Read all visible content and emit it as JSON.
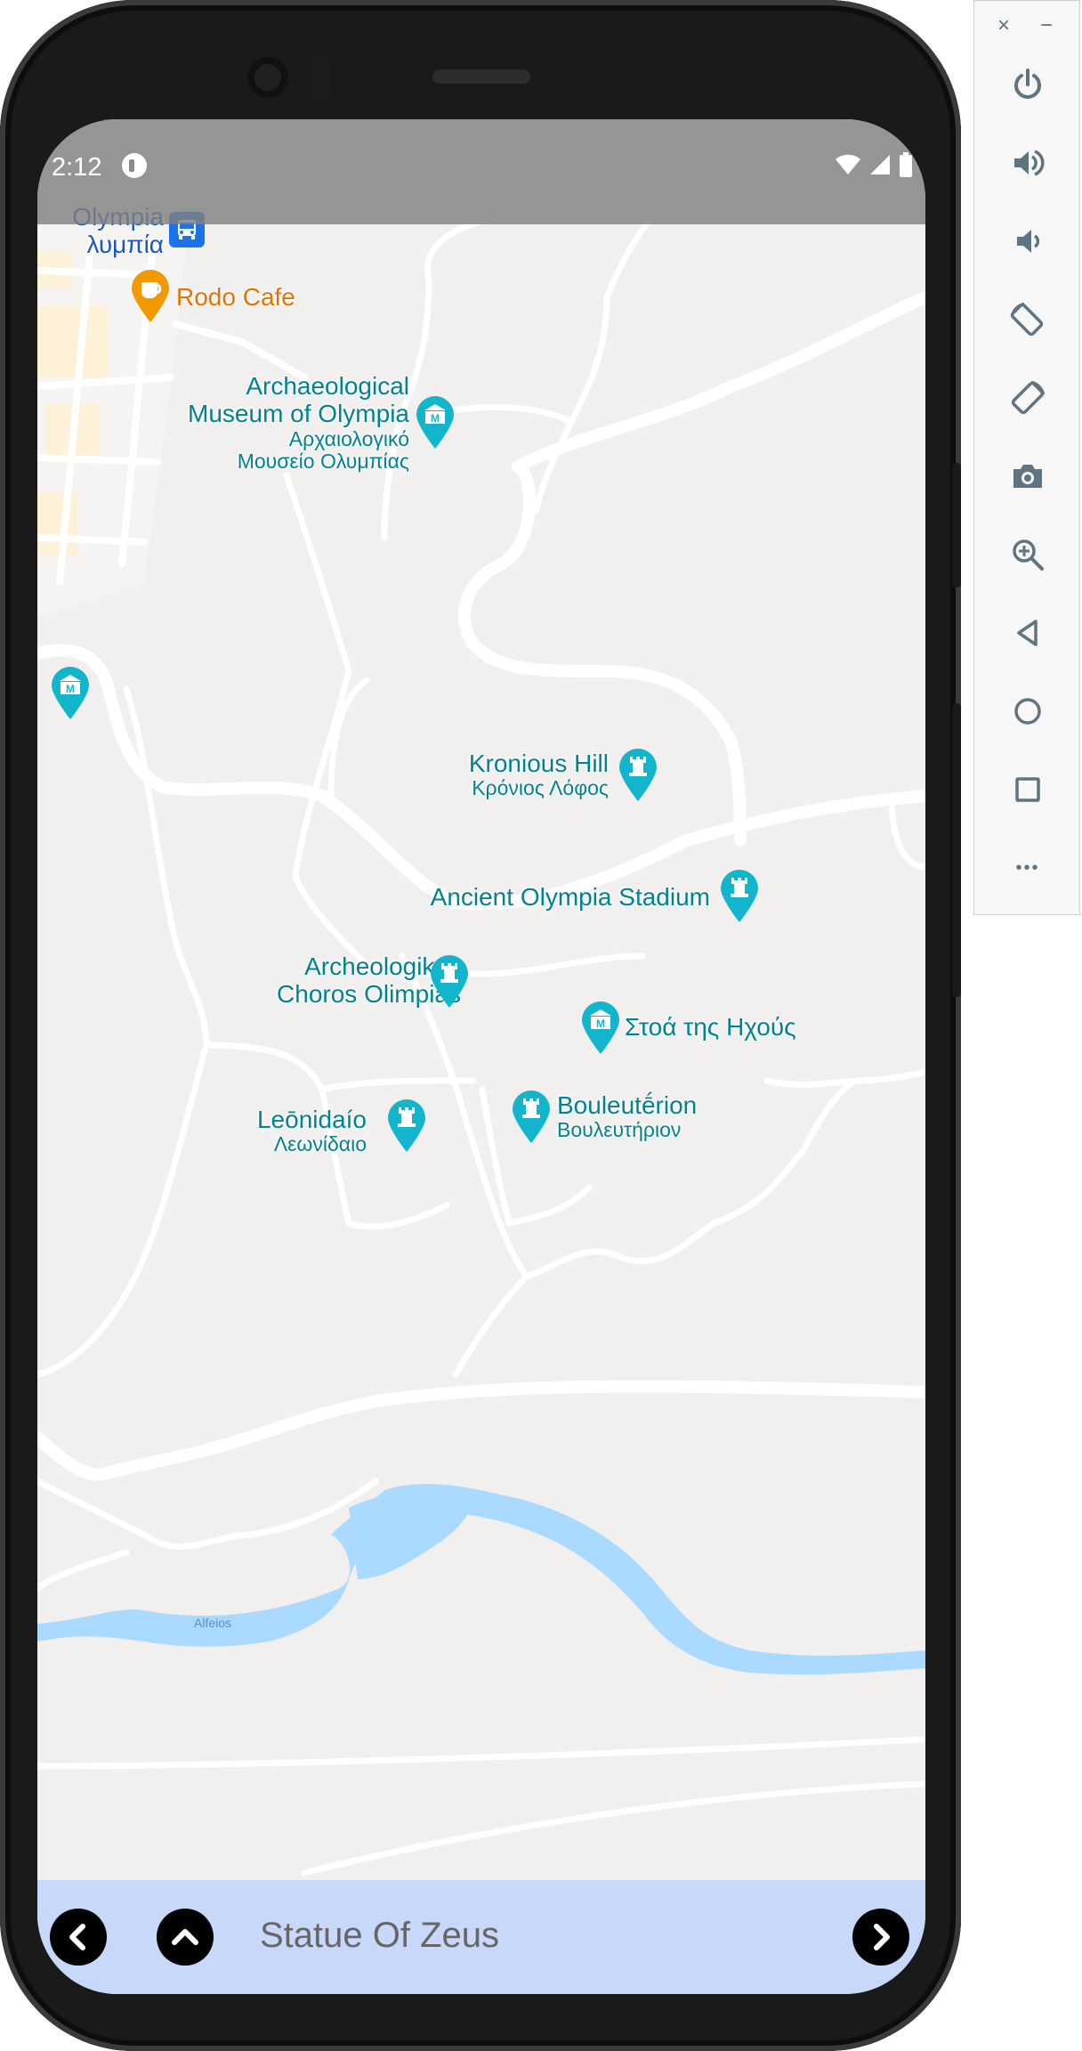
{
  "status_bar": {
    "time": "2:12"
  },
  "map": {
    "places": {
      "olympia_line1": "Olympia",
      "olympia_line2": "λυμπία",
      "rodo_cafe": "Rodo Cafe",
      "museum_line1": "Archaeological",
      "museum_line2": "Museum of Olympia",
      "museum_greek_line1": "Αρχαιολογικό",
      "museum_greek_line2": "Μουσείο Ολυμπίας",
      "kronious_hill": "Kronious Hill",
      "kronious_hill_greek": "Κρόνιος Λόφος",
      "stadium": "Ancient Olympia Stadium",
      "choros_line1": "Archeologikos",
      "choros_line2": "Choros Olimpias",
      "stoa": "Στοά της Ηχούς",
      "leonidaio": "Leōnidaío",
      "leonidaio_greek": "Λεωνίδαιο",
      "bouleuterion": "Bouleutḗrion",
      "bouleuterion_greek": "Βουλευτήριον",
      "river": "Alfeios"
    }
  },
  "bottom_bar": {
    "title": "Statue Of Zeus"
  },
  "emulator_panel": {
    "close": "×",
    "minimize": "−",
    "more": "•••"
  },
  "colors": {
    "map_bg": "#f1f0ef",
    "road": "#ffffff",
    "water": "#aadaff",
    "poi_teal": "#12b5cb",
    "poi_text": "#00838f",
    "cafe_orange": "#f29900",
    "bottom_bar": "#c8d8fb"
  }
}
